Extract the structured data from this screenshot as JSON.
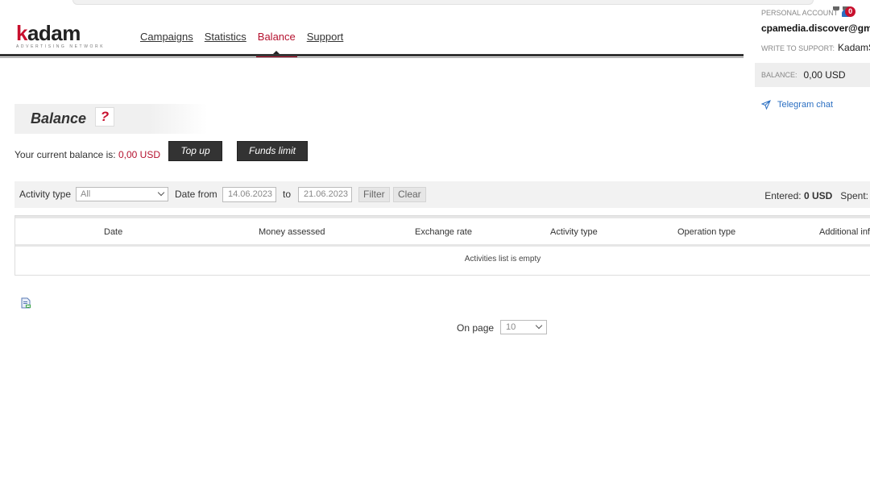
{
  "logo": {
    "brand_prefix": "k",
    "brand_rest": "adam",
    "tagline": "ADVERTISING NETWORK"
  },
  "nav": {
    "campaigns": "Campaigns",
    "statistics": "Statistics",
    "balance": "Balance",
    "support": "Support",
    "active": "Balance"
  },
  "account": {
    "personal_label": "PERSONAL ACCOUNT",
    "notifications": "0",
    "email": "cpamedia.discover@gmail.com",
    "support_label": "WRITE TO SUPPORT:",
    "support_value": "KadamSupport",
    "balance_label": "BALANCE:",
    "balance_value": "0,00 USD",
    "telegram": "Telegram chat"
  },
  "page": {
    "title": "Balance",
    "help": "?",
    "current_balance_label": "Your current balance is:",
    "current_balance_value": "0,00 USD",
    "topup_button": "Top up",
    "funds_limit_button": "Funds limit"
  },
  "filter": {
    "activity_type_label": "Activity type",
    "activity_type_value": "All",
    "date_from_label": "Date from",
    "date_from_value": "14.06.2023",
    "to_label": "to",
    "date_to_value": "21.06.2023",
    "filter_button": "Filter",
    "clear_button": "Clear",
    "entered_label": "Entered:",
    "entered_value": "0 USD",
    "spent_label": "Spent:"
  },
  "table": {
    "columns": [
      "Date",
      "Money assessed",
      "Exchange rate",
      "Activity type",
      "Operation type",
      "Additional info"
    ],
    "empty_text": "Activities list is empty"
  },
  "pagination": {
    "on_page_label": "On page",
    "on_page_value": "10"
  },
  "colors": {
    "accent": "#b5122f",
    "link": "#2b6fc2",
    "dark_button": "#333333"
  }
}
